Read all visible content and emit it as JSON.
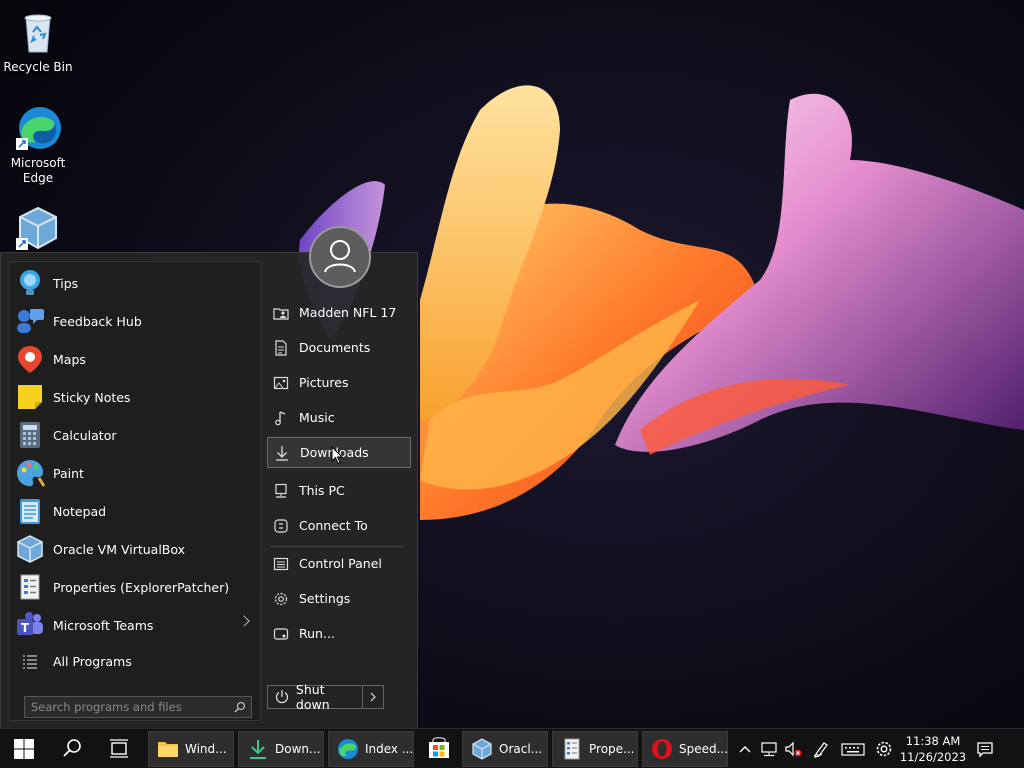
{
  "desktop": {
    "icons": [
      {
        "label": "Recycle Bin"
      },
      {
        "label": "Microsoft Edge"
      },
      {
        "label": ""
      }
    ]
  },
  "start_menu": {
    "programs": [
      {
        "label": "Tips",
        "icon": "lightbulb-icon"
      },
      {
        "label": "Feedback Hub",
        "icon": "feedback-icon"
      },
      {
        "label": "Maps",
        "icon": "map-pin-icon"
      },
      {
        "label": "Sticky Notes",
        "icon": "sticky-note-icon"
      },
      {
        "label": "Calculator",
        "icon": "calculator-icon"
      },
      {
        "label": "Paint",
        "icon": "palette-icon"
      },
      {
        "label": "Notepad",
        "icon": "notepad-icon"
      },
      {
        "label": "Oracle VM VirtualBox",
        "icon": "virtualbox-icon"
      },
      {
        "label": "Properties (ExplorerPatcher)",
        "icon": "properties-icon"
      },
      {
        "label": "Microsoft Teams",
        "icon": "teams-icon"
      }
    ],
    "all_programs": "All Programs",
    "search_placeholder": "Search programs and files",
    "places": [
      {
        "label": "Madden NFL 17",
        "icon": "user-folder-icon"
      },
      {
        "label": "Documents",
        "icon": "document-icon"
      },
      {
        "label": "Pictures",
        "icon": "picture-icon"
      },
      {
        "label": "Music",
        "icon": "music-note-icon"
      },
      {
        "label": "Downloads",
        "icon": "download-icon"
      },
      {
        "label": "This PC",
        "icon": "computer-icon"
      },
      {
        "label": "Connect To",
        "icon": "connect-icon"
      },
      {
        "label": "Control Panel",
        "icon": "control-panel-icon"
      },
      {
        "label": "Settings",
        "icon": "gear-icon"
      },
      {
        "label": "Run...",
        "icon": "run-icon"
      }
    ],
    "shutdown_label": "Shut down"
  },
  "taskbar": {
    "apps": [
      {
        "label": "Wind...",
        "icon": "folder-icon"
      },
      {
        "label": "Down...",
        "icon": "download-icon"
      },
      {
        "label": "Index ...",
        "icon": "edge-icon"
      },
      {
        "label": "",
        "icon": "store-icon"
      },
      {
        "label": "Oracl...",
        "icon": "virtualbox-icon"
      },
      {
        "label": "Prope...",
        "icon": "properties-icon"
      },
      {
        "label": "Speed...",
        "icon": "opera-icon"
      }
    ],
    "time": "11:38 AM",
    "date": "11/26/2023"
  },
  "colors": {
    "menu_bg": "#262626",
    "taskbar_bg": "#121212",
    "accent": "#0078d4"
  }
}
